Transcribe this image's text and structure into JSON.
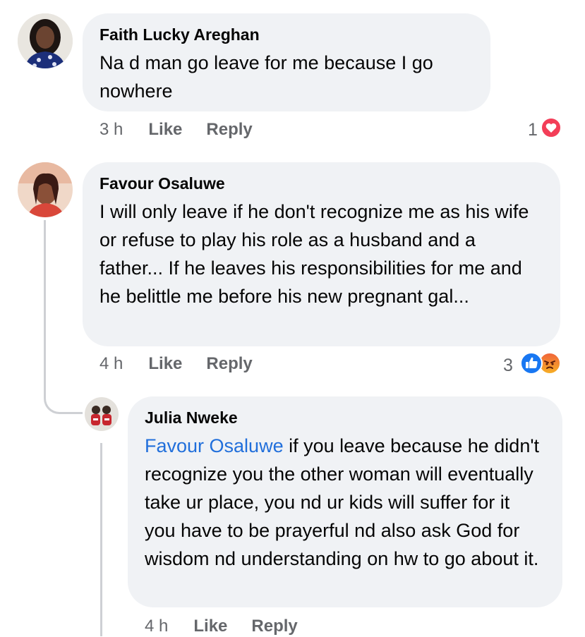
{
  "comments": [
    {
      "author": "Faith Lucky Areghan",
      "text": "Na d man go leave for me because I go nowhere",
      "time": "3 h",
      "like_label": "Like",
      "reply_label": "Reply",
      "reaction_count": "1",
      "reactions": [
        "love-icon"
      ]
    },
    {
      "author": "Favour Osaluwe",
      "text": "I will only leave if he don't recognize me as his wife or refuse to play his role as a husband and a father... If he leaves his responsibilities for me and he belittle me before his new pregnant gal...",
      "time": "4 h",
      "like_label": "Like",
      "reply_label": "Reply",
      "reaction_count": "3",
      "reactions": [
        "like-icon",
        "angry-icon"
      ]
    },
    {
      "author": "Julia Nweke",
      "mention": "Favour Osaluwe",
      "text": " if you leave because he didn't recognize you the other woman will eventually take ur place, you nd ur kids will suffer for it you have to be prayerful nd also ask God for wisdom nd understanding on hw to go about it.",
      "time": "4 h",
      "like_label": "Like",
      "reply_label": "Reply"
    }
  ],
  "colors": {
    "bubble": "#f0f2f5",
    "meta": "#65676b",
    "mention": "#216fdb",
    "love": "#f33e58",
    "like": "#1877f2",
    "angry": "#f0633b"
  }
}
